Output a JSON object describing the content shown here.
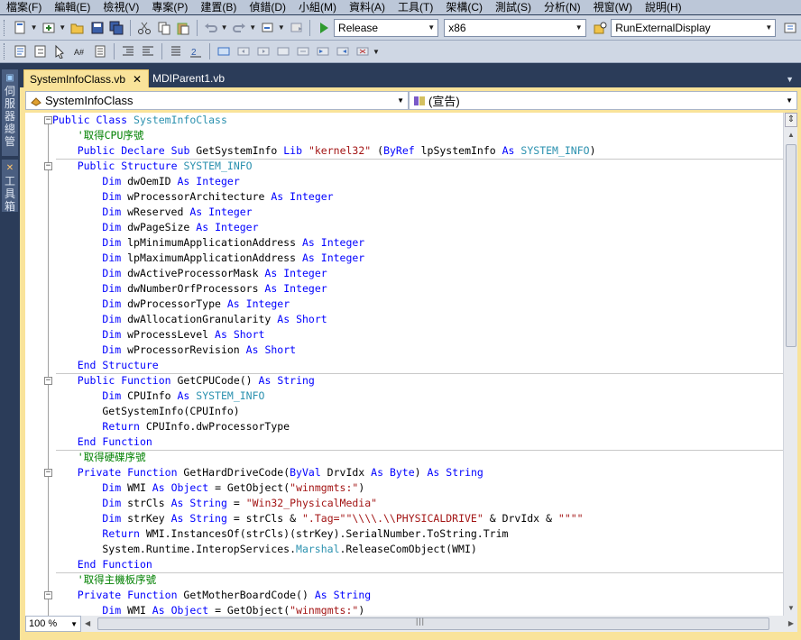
{
  "menu": [
    "檔案(F)",
    "編輯(E)",
    "檢視(V)",
    "專案(P)",
    "建置(B)",
    "偵錯(D)",
    "小組(M)",
    "資料(A)",
    "工具(T)",
    "架構(C)",
    "測試(S)",
    "分析(N)",
    "視窗(W)",
    "說明(H)"
  ],
  "toolbar": {
    "configuration": "Release",
    "platform": "x86",
    "find_target": "RunExternalDisplay"
  },
  "side_tabs": {
    "server_explorer": "伺服器總管",
    "toolbox": "工具箱"
  },
  "doc_tabs": [
    {
      "label": "SystemInfoClass.vb",
      "close": "✕"
    },
    {
      "label": "MDIParent1.vb"
    }
  ],
  "nav": {
    "class_combo": "SystemInfoClass",
    "member_combo": "(宣告)"
  },
  "code_lines": [
    [
      "Public Class SystemInfoClass"
    ],
    [
      "    '取得CPU序號"
    ],
    [
      "    Public Declare Sub GetSystemInfo Lib \"kernel32\" (ByRef lpSystemInfo As SYSTEM_INFO)"
    ],
    [
      "    Public Structure SYSTEM_INFO"
    ],
    [
      "        Dim dwOemID As Integer"
    ],
    [
      "        Dim wProcessorArchitecture As Integer"
    ],
    [
      "        Dim wReserved As Integer"
    ],
    [
      "        Dim dwPageSize As Integer"
    ],
    [
      "        Dim lpMinimumApplicationAddress As Integer"
    ],
    [
      "        Dim lpMaximumApplicationAddress As Integer"
    ],
    [
      "        Dim dwActiveProcessorMask As Integer"
    ],
    [
      "        Dim dwNumberOrfProcessors As Integer"
    ],
    [
      "        Dim dwProcessorType As Integer"
    ],
    [
      "        Dim dwAllocationGranularity As Short"
    ],
    [
      "        Dim wProcessLevel As Short"
    ],
    [
      "        Dim wProcessorRevision As Short"
    ],
    [
      "    End Structure"
    ],
    [
      "    Public Function GetCPUCode() As String"
    ],
    [
      "        Dim CPUInfo As SYSTEM_INFO"
    ],
    [
      "        GetSystemInfo(CPUInfo)"
    ],
    [
      "        Return CPUInfo.dwProcessorType"
    ],
    [
      "    End Function"
    ],
    [
      "    '取得硬碟序號"
    ],
    [
      "    Private Function GetHardDriveCode(ByVal DrvIdx As Byte) As String"
    ],
    [
      "        Dim WMI As Object = GetObject(\"winmgmts:\")"
    ],
    [
      "        Dim strCls As String = \"Win32_PhysicalMedia\""
    ],
    [
      "        Dim strKey As String = strCls & \".Tag=\"\"\\\\\\\\.\\\\PHYSICALDRIVE\" & DrvIdx & \"\"\"\""
    ],
    [
      "        Return WMI.InstancesOf(strCls)(strKey).SerialNumber.ToString.Trim"
    ],
    [
      "        System.Runtime.InteropServices.Marshal.ReleaseComObject(WMI)"
    ],
    [
      "    End Function"
    ],
    [
      "    '取得主機板序號"
    ],
    [
      "    Private Function GetMotherBoardCode() As String"
    ],
    [
      "        Dim WMI As Object = GetObject(\"winmgmts:\")"
    ]
  ],
  "zoom": "100 %"
}
